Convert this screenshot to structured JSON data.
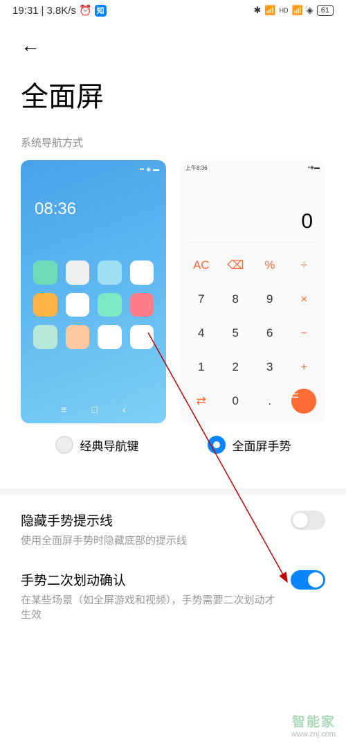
{
  "status_bar": {
    "time": "19:31",
    "speed": "3.8K/s",
    "zhi_badge": "知",
    "battery": "61"
  },
  "page": {
    "title": "全面屏",
    "section_label": "系统导航方式"
  },
  "preview_classic": {
    "time": "08:36",
    "icon_colors": [
      "#6fd9b8",
      "#f0f0f0",
      "#9fe0f5",
      "#ffffff",
      "#ffb347",
      "#ffffff",
      "#7de8c4",
      "#ff7b8a",
      "#b5e8d8",
      "#ffc9a0",
      "#ffffff",
      "#ffffff"
    ],
    "nav": [
      "≡",
      "□",
      "‹"
    ]
  },
  "preview_calc": {
    "status_time": "上午8:36",
    "display": "0",
    "buttons": [
      {
        "t": "AC",
        "c": "op"
      },
      {
        "t": "⌫",
        "c": "op"
      },
      {
        "t": "%",
        "c": "op"
      },
      {
        "t": "÷",
        "c": "op"
      },
      {
        "t": "7",
        "c": ""
      },
      {
        "t": "8",
        "c": ""
      },
      {
        "t": "9",
        "c": ""
      },
      {
        "t": "×",
        "c": "op"
      },
      {
        "t": "4",
        "c": ""
      },
      {
        "t": "5",
        "c": ""
      },
      {
        "t": "6",
        "c": ""
      },
      {
        "t": "−",
        "c": "op"
      },
      {
        "t": "1",
        "c": ""
      },
      {
        "t": "2",
        "c": ""
      },
      {
        "t": "3",
        "c": ""
      },
      {
        "t": "+",
        "c": "op"
      },
      {
        "t": "⇄",
        "c": "op"
      },
      {
        "t": "0",
        "c": ""
      },
      {
        "t": ".",
        "c": ""
      },
      {
        "t": "=",
        "c": "eq"
      }
    ]
  },
  "nav_options": {
    "classic": "经典导航键",
    "gesture": "全面屏手势"
  },
  "settings": {
    "hide_line_title": "隐藏手势提示线",
    "hide_line_desc": "使用全面屏手势时隐藏底部的提示线",
    "double_swipe_title": "手势二次划动确认",
    "double_swipe_desc": "在某些场景（如全屏游戏和视频），手势需要二次划动才生效"
  },
  "watermark": {
    "cn": "智能家",
    "url": "www.znj.com"
  }
}
